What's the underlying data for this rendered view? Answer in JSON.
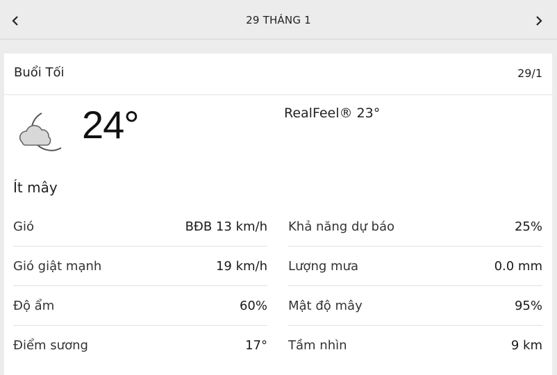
{
  "header": {
    "title": "29 THÁNG 1",
    "prev_icon": "chevron-left-icon",
    "next_icon": "chevron-right-icon"
  },
  "card": {
    "period": "Buổi Tối",
    "date_short": "29/1",
    "weather_icon": "moon-cloud-icon",
    "temperature": "24°",
    "realfeel": "RealFeel® 23°",
    "condition": "Ít mây",
    "left_details": [
      {
        "label": "Gió",
        "value": "BĐB 13 km/h"
      },
      {
        "label": "Gió giật mạnh",
        "value": "19 km/h"
      },
      {
        "label": "Độ ẩm",
        "value": "60%"
      },
      {
        "label": "Điểm sương",
        "value": "17°"
      }
    ],
    "right_details": [
      {
        "label": "Khả năng dự báo",
        "value": "25%"
      },
      {
        "label": "Lượng mưa",
        "value": "0.0 mm"
      },
      {
        "label": "Mật độ mây",
        "value": "95%"
      },
      {
        "label": "Tầm nhìn",
        "value": "9 km"
      }
    ]
  }
}
